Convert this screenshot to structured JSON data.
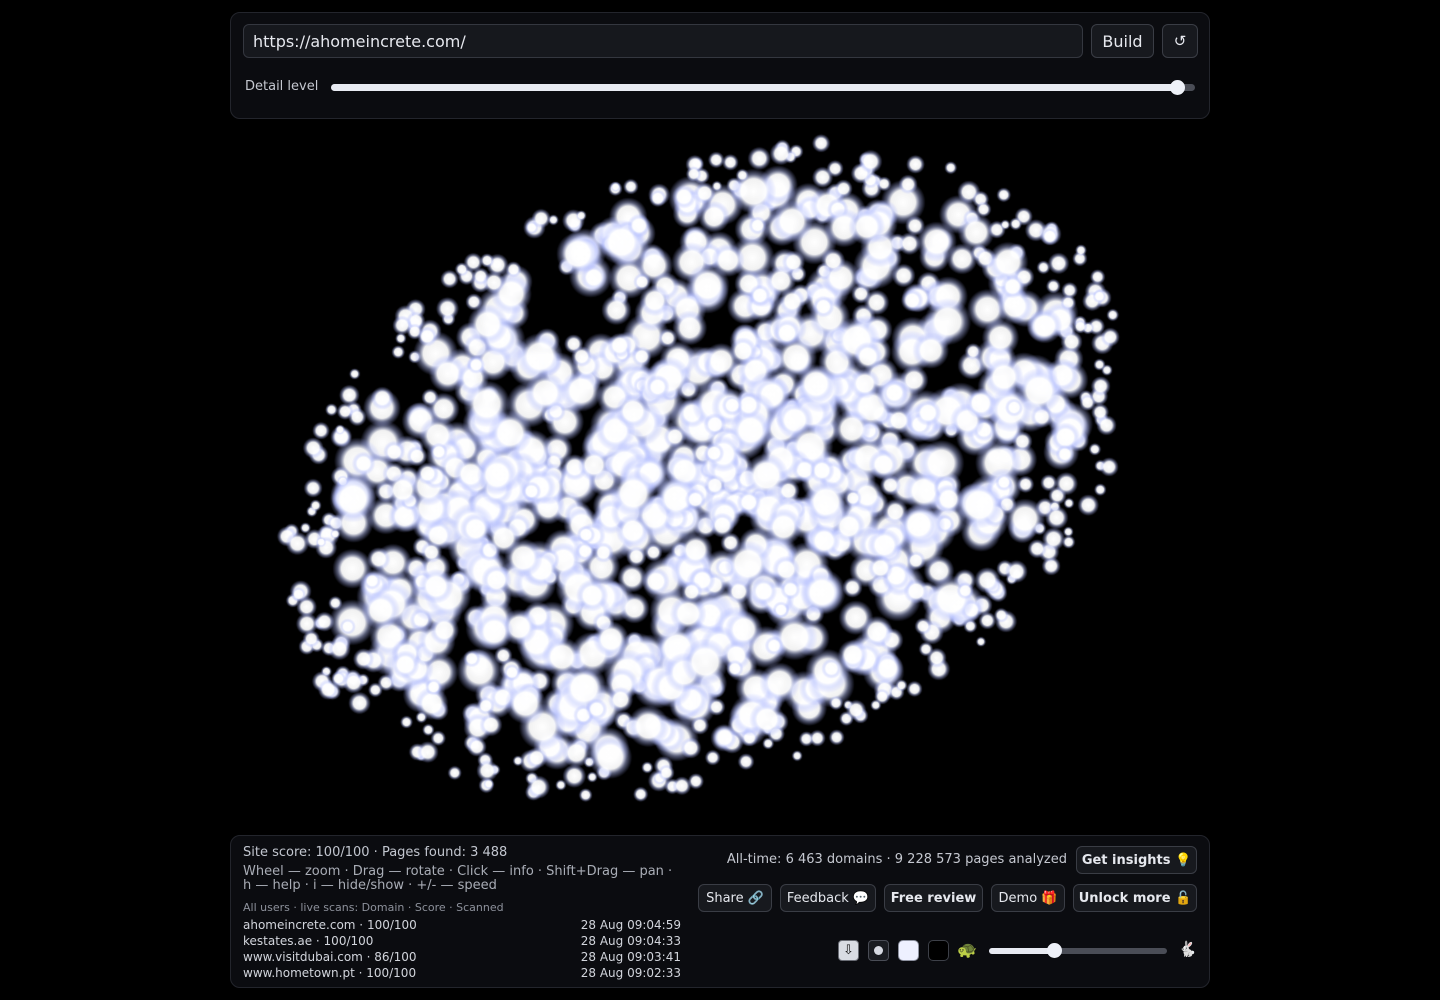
{
  "top": {
    "url_value": "https://ahomeincrete.com/",
    "build_label": "Build",
    "reset_label": "↺",
    "detail_label": "Detail level",
    "detail_value": 0.98
  },
  "info": {
    "score_line": "Site score: 100/100 · Pages found: 3 488",
    "help_line": "Wheel — zoom · Drag — rotate · Click — info · Shift+Drag — pan · h — help · i — hide/show · +/- — speed",
    "scans_title": "All users · live scans: Domain · Score · Scanned",
    "scans": [
      {
        "domain": "ahomeincrete.com · 100/100",
        "time": "28 Aug 09:04:59"
      },
      {
        "domain": "kestates.ae · 100/100",
        "time": "28 Aug 09:04:33"
      },
      {
        "domain": "www.visitdubai.com · 86/100",
        "time": "28 Aug 09:03:41"
      },
      {
        "domain": "www.hometown.pt · 100/100",
        "time": "28 Aug 09:02:33"
      }
    ]
  },
  "stats": {
    "alltime": "All-time: 6 463 domains · 9 228 573 pages analyzed"
  },
  "buttons": {
    "insights": "Get insights 💡",
    "share": "Share 🔗",
    "feedback": "Feedback 💬",
    "review": "Free review",
    "demo": "Demo 🎁",
    "unlock": "Unlock more 🔓"
  },
  "controls": {
    "download_icon": "⇩",
    "turtle_icon": "🐢",
    "rabbit_icon": "🐇",
    "speed_value": 0.37,
    "swatch_light": "#eef0ff",
    "swatch_dark": "#000000"
  },
  "colors": {
    "background": "#000000",
    "cloud": "#ffffff",
    "glow": "#aeb8ff"
  }
}
